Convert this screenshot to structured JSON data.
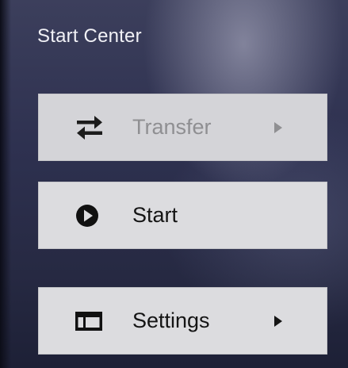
{
  "header": {
    "title": "Start Center"
  },
  "menu": {
    "items": [
      {
        "id": "transfer",
        "label": "Transfer",
        "icon": "transfer-arrows-icon",
        "has_submenu": true,
        "enabled": false
      },
      {
        "id": "start",
        "label": "Start",
        "icon": "play-circle-icon",
        "has_submenu": false,
        "enabled": true
      },
      {
        "id": "settings",
        "label": "Settings",
        "icon": "settings-panel-icon",
        "has_submenu": true,
        "enabled": true
      }
    ]
  },
  "colors": {
    "button_bg": "#dcdcdf",
    "label_enabled": "#141414",
    "label_disabled": "#8f8f92",
    "title_text": "#f1f1f6"
  }
}
